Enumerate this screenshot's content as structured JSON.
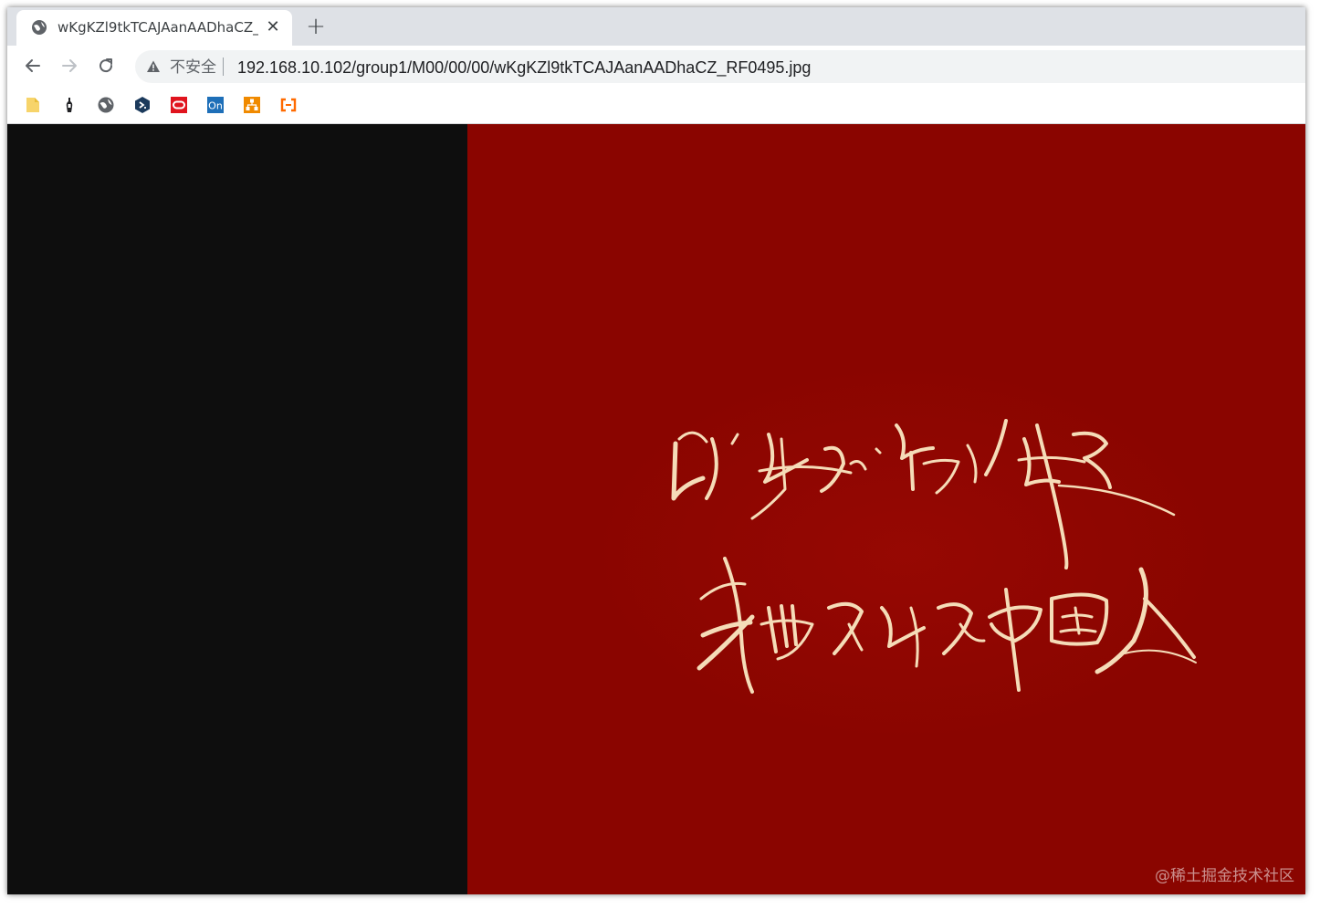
{
  "browser": {
    "tab": {
      "title": "wKgKZl9tkTCAJAanAADhaCZ_RF0495.jpg",
      "favicon": "globe-icon",
      "close_label": "✕"
    },
    "new_tab_label": "+",
    "toolbar": {
      "back": "back-arrow-icon",
      "forward": "forward-arrow-icon",
      "reload": "reload-icon"
    },
    "omnibox": {
      "security_icon": "warning-triangle-icon",
      "security_label": "不安全",
      "url": "192.168.10.102/group1/M00/00/00/wKgKZl9tkTCAJAanAADhaCZ_RF0495.jpg"
    },
    "bookmarks": [
      {
        "icon": "folder-icon",
        "color": "#f5d76e"
      },
      {
        "icon": "bottle-icon",
        "color": "#202124"
      },
      {
        "icon": "globe-icon",
        "color": "#5f6368"
      },
      {
        "icon": "hexagon-code-icon",
        "color": "#1b3a5c"
      },
      {
        "icon": "oracle-icon",
        "color": "#e0141e"
      },
      {
        "icon": "on-icon",
        "color": "#1e6fb8"
      },
      {
        "icon": "network-icon",
        "color": "#f08a00"
      },
      {
        "icon": "alibaba-cloud-icon",
        "color": "#ff6a00"
      }
    ]
  },
  "page": {
    "image_background": "#8a0500",
    "calligraphy_color": "#f5dcb8",
    "watermark": "@稀土掘金技术社区"
  }
}
